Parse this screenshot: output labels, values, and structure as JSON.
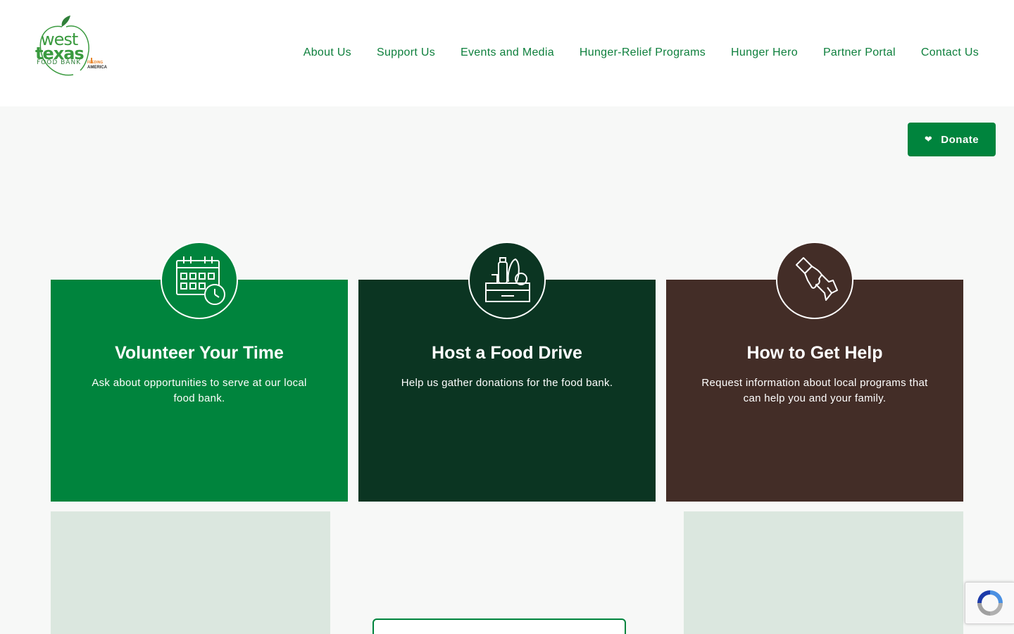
{
  "logo": {
    "line1": "west",
    "line2": "texas",
    "line3": "FOOD BANK",
    "partner1": "FEEDING",
    "partner2": "AMERICA"
  },
  "nav": {
    "items": [
      {
        "label": "About Us"
      },
      {
        "label": "Support Us"
      },
      {
        "label": "Events and Media"
      },
      {
        "label": "Hunger-Relief Programs"
      },
      {
        "label": "Hunger Hero"
      },
      {
        "label": "Partner Portal"
      },
      {
        "label": "Contact Us"
      }
    ]
  },
  "donate": {
    "label": "Donate",
    "icon": "heart-icon"
  },
  "cards": [
    {
      "title": "Volunteer Your Time",
      "desc": "Ask about opportunities to serve at our local food bank.",
      "icon": "calendar-clock-icon",
      "color": "#00843d"
    },
    {
      "title": "Host a Food Drive",
      "desc": "Help us gather donations for the food bank.",
      "icon": "grocery-crate-icon",
      "color": "#0b3522"
    },
    {
      "title": "How to Get Help",
      "desc": "Request information about local programs that can help you and your family.",
      "icon": "helping-hands-icon",
      "color": "#432d27"
    }
  ],
  "colors": {
    "brand_green": "#00843d",
    "nav_text": "#0d7f3c",
    "dark_green": "#0b3522",
    "brown": "#432d27",
    "panel": "#dbe7df"
  }
}
